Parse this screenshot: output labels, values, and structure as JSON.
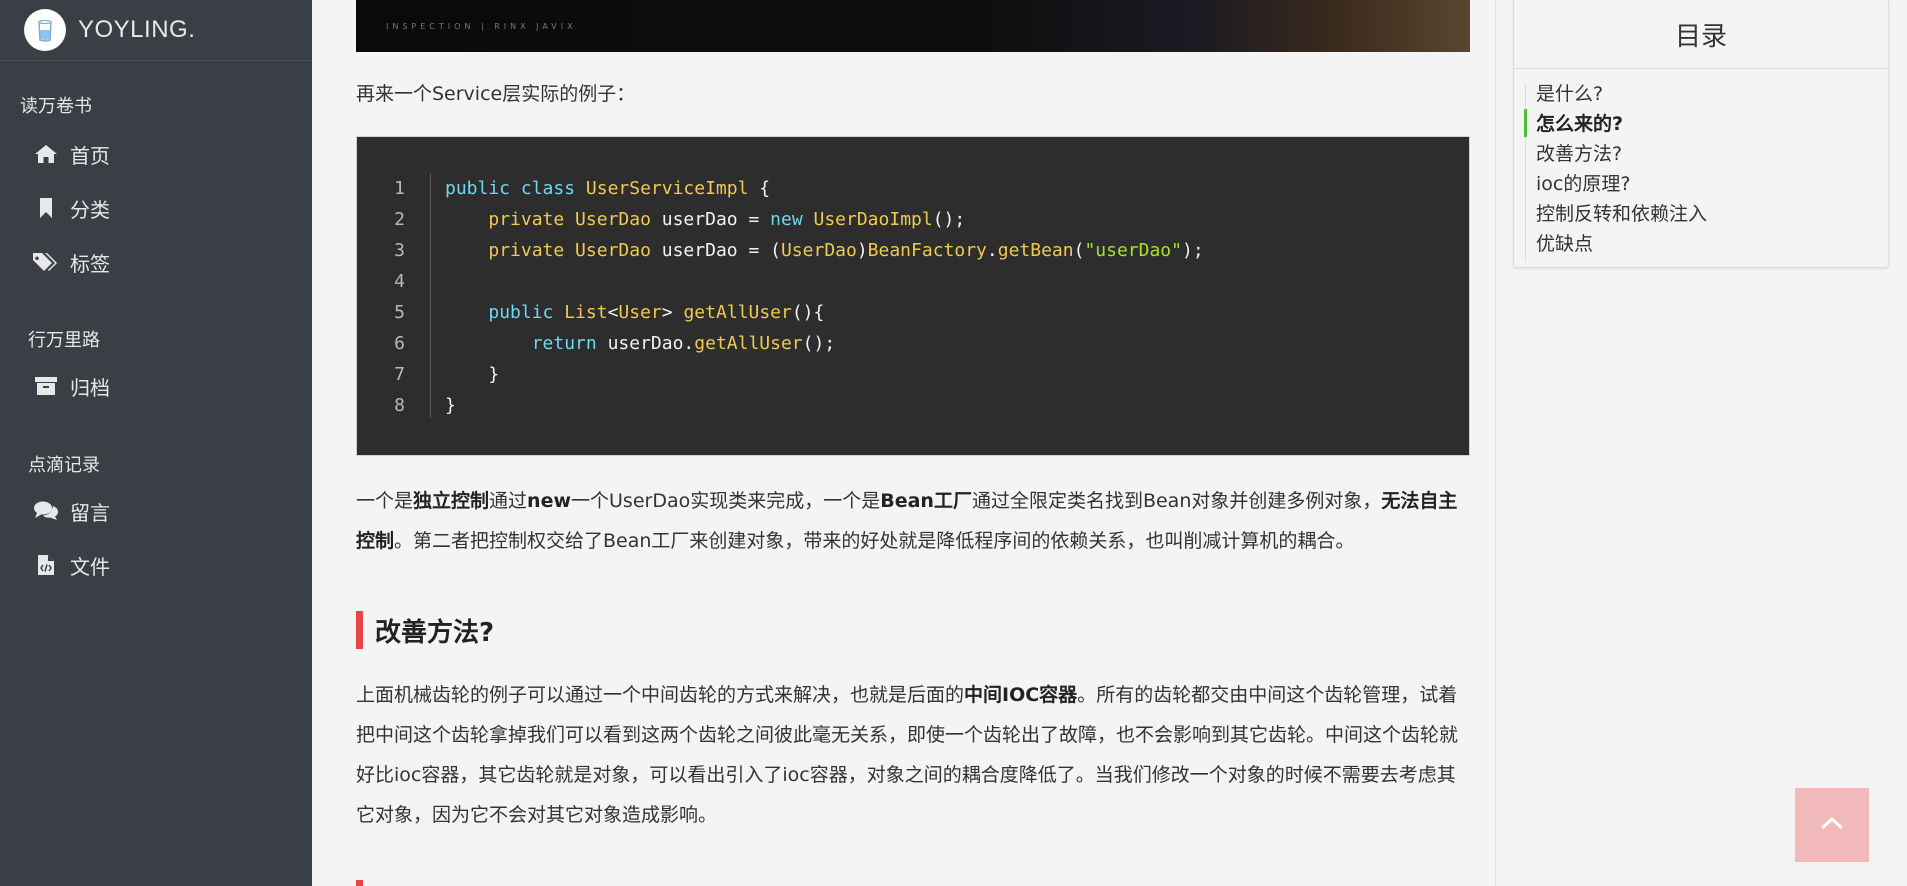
{
  "brand": {
    "name": "YOYLING."
  },
  "sidebar": {
    "groups": [
      {
        "title": "读万卷书",
        "items": [
          {
            "label": "首页",
            "icon": "home-icon"
          },
          {
            "label": "分类",
            "icon": "bookmark-icon"
          },
          {
            "label": "标签",
            "icon": "tags-icon"
          }
        ]
      },
      {
        "title": "行万里路",
        "items": [
          {
            "label": "归档",
            "icon": "archive-icon"
          }
        ]
      },
      {
        "title": "点滴记录",
        "items": [
          {
            "label": "留言",
            "icon": "comments-icon"
          },
          {
            "label": "文件",
            "icon": "file-code-icon"
          }
        ]
      }
    ]
  },
  "article": {
    "hero_caption": "INSPECTION | RINX JAVIX",
    "intro": "再来一个Service层实际的例子：",
    "code_line_numbers": [
      "1",
      "2",
      "3",
      "4",
      "5",
      "6",
      "7",
      "8"
    ],
    "para2": {
      "t1": "一个是",
      "b1": "独立控制",
      "t2": "通过",
      "b2": "new",
      "t3": "一个UserDao实现类来完成，一个是",
      "b3": "Bean工厂",
      "t4": "通过全限定类名找到Bean对象并创建多例对象，",
      "b4": "无法自主控制",
      "t5": "。第二者把控制权交给了Bean工厂来创建对象，带来的好处就是降低程序间的依赖关系，也叫削减计算机的耦合。"
    },
    "section_heading": "改善方法?",
    "para3": {
      "t1": "上面机械齿轮的例子可以通过一个中间齿轮的方式来解决，也就是后面的",
      "b1": "中间IOC容器",
      "t2": "。所有的齿轮都交由中间这个齿轮管理，试着把中间这个齿轮拿掉我们可以看到这两个齿轮之间彼此毫无关系，即使一个齿轮出了故障，也不会影响到其它齿轮。中间这个齿轮就好比ioc容器，其它齿轮就是对象，可以看出引入了ioc容器，对象之间的耦合度降低了。当我们修改一个对象的时候不需要去考虑其它对象，因为它不会对其它对象造成影响。"
    }
  },
  "toc": {
    "title": "目录",
    "items": [
      "是什么?",
      "怎么来的?",
      "改善方法?",
      "ioc的原理?",
      "控制反转和依赖注入",
      "优缺点"
    ],
    "active_index": 1
  },
  "colors": {
    "sidebar_bg": "#3a3f45",
    "heading_accent": "#e8454a",
    "toc_active_mark": "#4fbf3a",
    "back_top_bg": "#f1b9b9"
  }
}
